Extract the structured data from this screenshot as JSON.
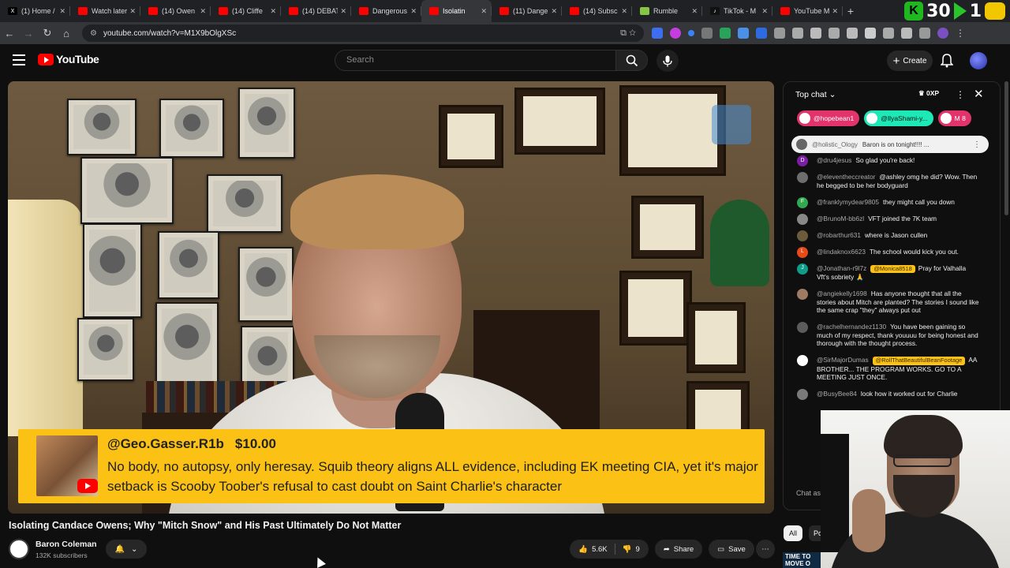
{
  "browser": {
    "tabs": [
      {
        "title": "(1) Home /",
        "fav": "x-icon",
        "color": "#000000",
        "glyph": "X"
      },
      {
        "title": "Watch later",
        "fav": "youtube-icon",
        "color": "#ff0000",
        "glyph": ""
      },
      {
        "title": "(14) Owen",
        "fav": "youtube-icon",
        "color": "#ff0000",
        "glyph": ""
      },
      {
        "title": "(14) Cliffe",
        "fav": "youtube-icon",
        "color": "#ff0000",
        "glyph": ""
      },
      {
        "title": "(14) DEBAT",
        "fav": "youtube-icon",
        "color": "#ff0000",
        "glyph": ""
      },
      {
        "title": "Dangerous",
        "fav": "youtube-icon",
        "color": "#ff0000",
        "glyph": ""
      },
      {
        "title": "Isolatin",
        "fav": "youtube-icon",
        "color": "#ff0000",
        "glyph": "",
        "active": true
      },
      {
        "title": "(11) Dange",
        "fav": "youtube-icon",
        "color": "#ff0000",
        "glyph": ""
      },
      {
        "title": "(14) Subsc",
        "fav": "youtube-icon",
        "color": "#ff0000",
        "glyph": ""
      },
      {
        "title": "Rumble",
        "fav": "rumble-icon",
        "color": "#85c742",
        "glyph": ""
      },
      {
        "title": "TikTok - M",
        "fav": "tiktok-icon",
        "color": "#111111",
        "glyph": "♪"
      },
      {
        "title": "YouTube M",
        "fav": "youtube-music-icon",
        "color": "#ff0000",
        "glyph": ""
      }
    ],
    "new_tab": "+",
    "overlay_counter_a": "30",
    "overlay_counter_b": "1",
    "url": "youtube.com/watch?v=M1X9bOlgXSc"
  },
  "youtube": {
    "logo_text": "YouTube",
    "search_placeholder": "Search",
    "create_label": "Create"
  },
  "video": {
    "superchat": {
      "user": "@Geo.Gasser.R1b",
      "amount": "$10.00",
      "message": "No body, no autopsy, only heresay. Squib theory aligns ALL evidence, including EK meeting CIA, yet it's major setback is Scooby Toober's refusal to cast doubt on Saint Charlie's character"
    },
    "title": "Isolating Candace Owens; Why \"Mitch Snow\" and His Past Ultimately Do Not Matter",
    "channel": "Baron Coleman",
    "subscribers": "132K subscribers",
    "likes": "5.6K",
    "dislikes": "9",
    "share_label": "Share",
    "save_label": "Save"
  },
  "chat": {
    "header": "Top chat",
    "xp": "0XP",
    "pinned_chips": [
      {
        "label": "@hopebean1",
        "color": "#e2336b"
      },
      {
        "label": "@IlyaShami-y...",
        "color": "#1de9b6",
        "text_color": "#0f0f0f"
      },
      {
        "label": "M  8",
        "color": "#e2336b"
      }
    ],
    "pinned_message": {
      "user": "@holistic_Ology",
      "text": "Baron is on tonight!!!! ..."
    },
    "messages": [
      {
        "avatar": "D",
        "color": "#7b1fa2",
        "user": "@dru4jesus",
        "text": "So glad you're back!"
      },
      {
        "avatar": "",
        "color": "#6d6d6d",
        "user": "@eleventheccreator",
        "text": "@ashley omg he did? Wow. Then he begged to be her bodyguard"
      },
      {
        "avatar": "F",
        "color": "#33a852",
        "user": "@franklymydear9805",
        "text": "they might call you down"
      },
      {
        "avatar": "",
        "color": "#888888",
        "user": "@BrunoM-bb6zl",
        "text": "VFT joined the 7K team"
      },
      {
        "avatar": "",
        "color": "#6b5b3a",
        "user": "@robarthur631",
        "text": "where is Jason cullen"
      },
      {
        "avatar": "L",
        "color": "#e64a19",
        "user": "@lindaknox6623",
        "text": "The school would kick you out."
      },
      {
        "avatar": "J",
        "color": "#0f9d8a",
        "user": "@Jonathan-r9l7z",
        "tag": "@Monica8518",
        "text": "Pray for Valhalla Vft's sobriety 🙏"
      },
      {
        "avatar": "",
        "color": "#9e7b62",
        "user": "@angiekelly1698",
        "text": "Has anyone thought that all the stories about Mitch are planted? The stories I sound like the same crap \"they\" always put out"
      },
      {
        "avatar": "",
        "color": "#5c5c5c",
        "user": "@rachelhernandez1130",
        "text": "You have been gaining so much of my respect, thank youuuu for being honest and thorough with the thought process."
      },
      {
        "avatar": "",
        "color": "#ffffff",
        "user": "@SirMajorDumas",
        "tag": "@RollThatBeautifulBeanFootage",
        "text": "AA BROTHER... THE PROGRAM WORKS. GO TO A MEETING JUST ONCE."
      },
      {
        "avatar": "",
        "color": "#7a7a7a",
        "user": "@BusyBee84",
        "text": "look how it worked out for Charlie"
      }
    ],
    "input_placeholder": "Chat as",
    "filter_all": "All",
    "filter_second": "Po"
  },
  "promo_text": "TIME TO MOVE O"
}
